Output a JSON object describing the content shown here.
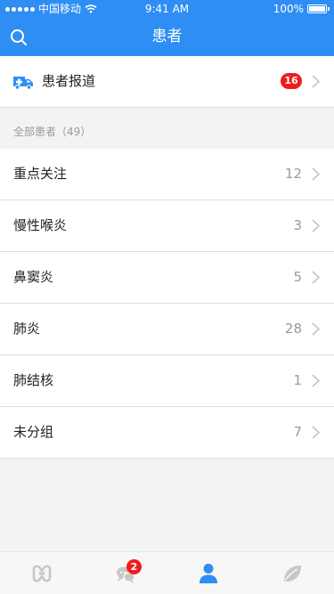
{
  "status_bar": {
    "carrier": "中国移动",
    "time": "9:41 AM",
    "battery": "100%"
  },
  "header": {
    "title": "患者"
  },
  "arrival": {
    "label": "患者报道",
    "badge": "16"
  },
  "section": {
    "title": "全部患者（49）"
  },
  "groups": [
    {
      "label": "重点关注",
      "count": "12"
    },
    {
      "label": "慢性喉炎",
      "count": "3"
    },
    {
      "label": "鼻窦炎",
      "count": "5"
    },
    {
      "label": "肺炎",
      "count": "28"
    },
    {
      "label": "肺结核",
      "count": "1"
    },
    {
      "label": "未分组",
      "count": "7"
    }
  ],
  "tabbar": {
    "tabs": [
      {
        "icon": "link-icon"
      },
      {
        "icon": "chat-icon",
        "badge": "2"
      },
      {
        "icon": "user-icon"
      },
      {
        "icon": "leaf-icon"
      }
    ],
    "active_color": "#2f8ef3",
    "inactive_color": "#c7c7c7"
  },
  "colors": {
    "primary": "#2f8ef3",
    "badge": "#ef1c1c"
  }
}
